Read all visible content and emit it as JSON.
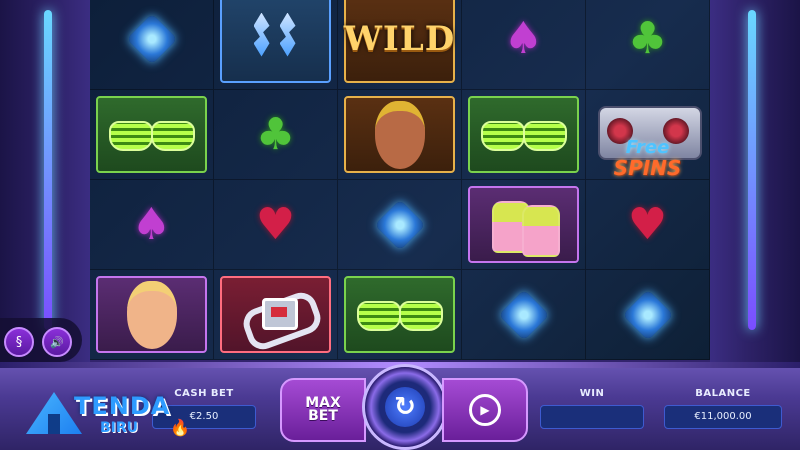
{
  "reels": {
    "row1": [
      {
        "symbol": "blue-gem"
      },
      {
        "symbol": "lightning-earrings"
      },
      {
        "symbol": "wild",
        "label": "WILD"
      },
      {
        "symbol": "spade"
      },
      {
        "symbol": "club"
      }
    ],
    "row2": [
      {
        "symbol": "green-shutter-glasses"
      },
      {
        "symbol": "club"
      },
      {
        "symbol": "woman-portrait"
      },
      {
        "symbol": "green-shutter-glasses"
      },
      {
        "symbol": "boombox-free-spins",
        "line1": "Free",
        "line2": "SPINS"
      }
    ],
    "row3": [
      {
        "symbol": "spade"
      },
      {
        "symbol": "heart"
      },
      {
        "symbol": "blue-gem"
      },
      {
        "symbol": "sneakers"
      },
      {
        "symbol": "heart"
      }
    ],
    "row4": [
      {
        "symbol": "man-portrait"
      },
      {
        "symbol": "wrist-watch"
      },
      {
        "symbol": "green-shutter-glasses"
      },
      {
        "symbol": "blue-gem"
      },
      {
        "symbol": "blue-gem"
      }
    ]
  },
  "side": {
    "paytable_glyph": "§",
    "sound_glyph": "🔊"
  },
  "controls": {
    "cash_bet_label": "CASH BET",
    "cash_bet_value": "€2.50",
    "max_bet_line1": "MAX",
    "max_bet_line2": "BET",
    "spin_glyph": "↻",
    "autoplay_glyph": "▶",
    "win_label": "WIN",
    "win_value": "",
    "balance_label": "BALANCE",
    "balance_value": "€11,000.00"
  },
  "watermark": {
    "line1": "TENDA",
    "line2": "BIRU",
    "badge": "TB"
  },
  "colors": {
    "accent": "#8a2fd8",
    "field_bg": "#1a2f7a",
    "frame": "#2e2268"
  }
}
